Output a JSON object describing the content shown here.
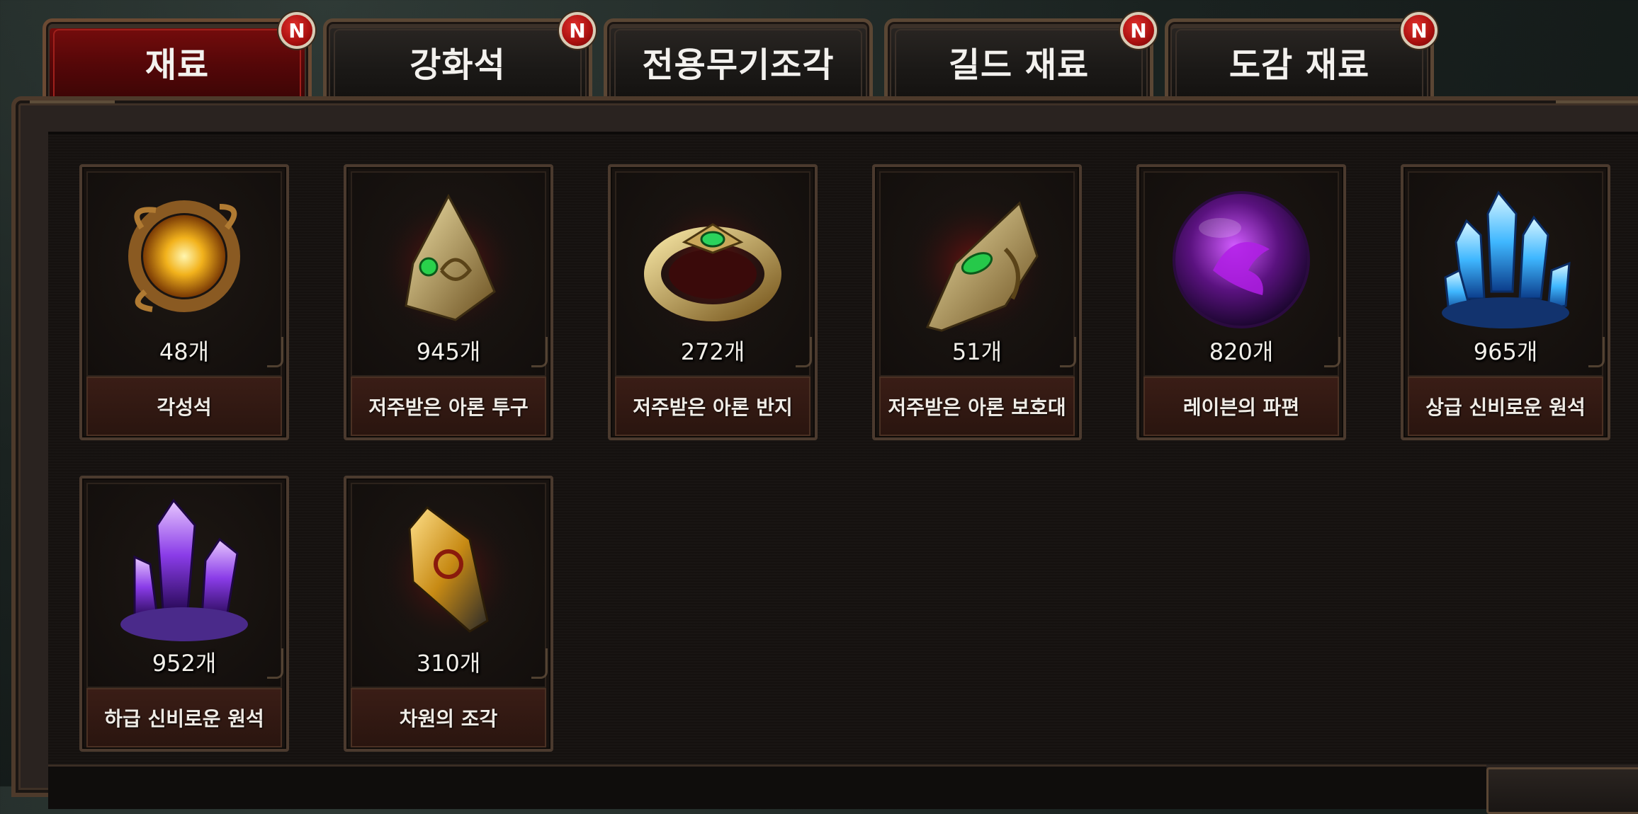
{
  "tabs": [
    {
      "label": "재료",
      "badge": "N",
      "active": true
    },
    {
      "label": "강화석",
      "badge": "N",
      "active": false
    },
    {
      "label": "전용무기조각",
      "badge": "",
      "active": false
    },
    {
      "label": "길드 재료",
      "badge": "N",
      "active": false
    },
    {
      "label": "도감 재료",
      "badge": "N",
      "active": false
    }
  ],
  "items": [
    {
      "count": "48개",
      "name": "각성석",
      "icon": "awakening-orb-icon"
    },
    {
      "count": "945개",
      "name": "저주받은 아론 투구",
      "icon": "helmet-icon"
    },
    {
      "count": "272개",
      "name": "저주받은 아론 반지",
      "icon": "ring-icon"
    },
    {
      "count": "51개",
      "name": "저주받은 아론 보호대",
      "icon": "bracer-icon"
    },
    {
      "count": "820개",
      "name": "레이븐의 파편",
      "icon": "purple-orb-icon"
    },
    {
      "count": "965개",
      "name": "상급 신비로운 원석",
      "icon": "blue-crystal-icon"
    },
    {
      "count": "952개",
      "name": "하급 신비로운 원석",
      "icon": "purple-crystal-icon"
    },
    {
      "count": "310개",
      "name": "차원의 조각",
      "icon": "dimension-shard-icon"
    }
  ],
  "colors": {
    "active_tab": "#6a0a0b",
    "badge": "#b5110f",
    "slot_border": "#4b3a2e"
  }
}
